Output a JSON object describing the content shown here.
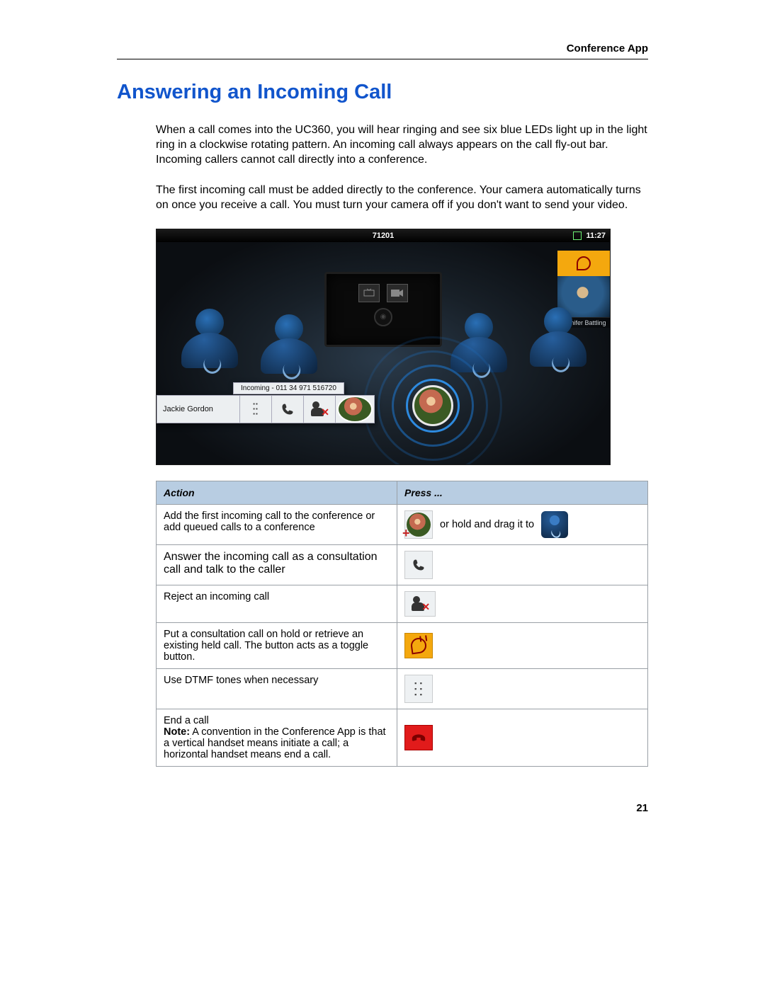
{
  "header": {
    "section": "Conference App"
  },
  "title": "Answering an Incoming Call",
  "paragraphs": {
    "p1": "When a call comes into the UC360, you will hear ringing and see six blue LEDs light up in the light ring in a clockwise rotating pattern. An incoming call always appears on the call fly-out bar. Incoming callers cannot call directly into a conference.",
    "p2": "The first incoming call must be added directly to the conference. Your camera automatically turns on once you receive a call. You must turn your camera off if you don't want to send your video."
  },
  "screenshot": {
    "status_center": "71201",
    "status_time": "11:27",
    "held_contact": "Jennifer Battling",
    "flyout_name": "Jackie Gordon",
    "incoming_label": "Incoming - 011 34 971 516720"
  },
  "table": {
    "headers": {
      "action": "Action",
      "press": "Press ..."
    },
    "rows": {
      "r1_action": "Add the first incoming call to the conference or add queued calls to a conference",
      "r1_mid": "or hold and drag it to",
      "r2_action": "Answer the incoming call as a consultation call and talk to the caller",
      "r3_action": "Reject an incoming call",
      "r4_action": "Put a consultation call on hold or retrieve an existing held call. The button acts as a toggle button.",
      "r5_action": "Use DTMF tones when necessary",
      "r6_action_1": "End a call",
      "r6_note_label": "Note:",
      "r6_note_text": " A convention in the Conference App is that a vertical handset means initiate a call; a horizontal handset means end a call."
    }
  },
  "pagenum": "21"
}
